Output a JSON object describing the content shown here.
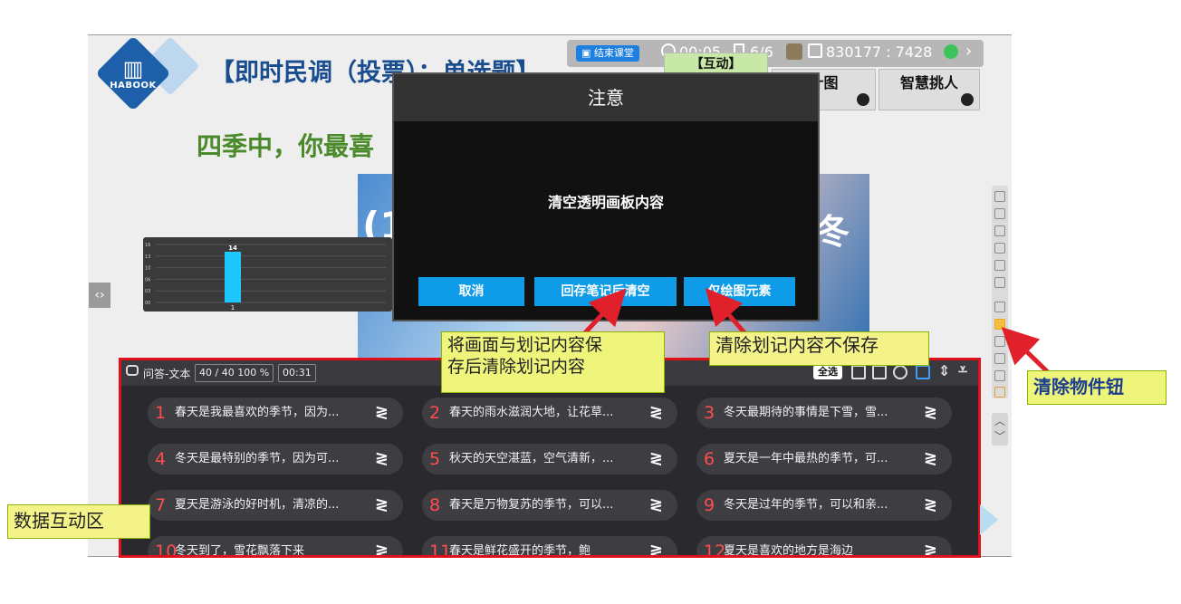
{
  "slide": {
    "logo_text": "HABOOK",
    "title": "【即时民调（投票）：单选题】",
    "question": "四季中，你最喜",
    "image_label_1": "(1",
    "image_label_2": "冬"
  },
  "mini_chart": {
    "chart_data": {
      "type": "bar",
      "categories": [
        "1"
      ],
      "values": [
        14
      ],
      "ytick_labels": [
        "00",
        "03",
        "06",
        "10",
        "13",
        "16"
      ],
      "ylim": [
        0,
        16
      ]
    }
  },
  "toolbar": {
    "end_class": "结束课堂",
    "timer": "00:05",
    "page": "6/6",
    "code": "830177 : 7428",
    "chevron": "›"
  },
  "feature_buttons": {
    "interact": "【互动】",
    "stats": "计图",
    "pick": "智慧挑人"
  },
  "modal": {
    "title": "注意",
    "message": "清空透明画板内容",
    "cancel": "取消",
    "save_and_clear": "回存笔记后清空",
    "clear_drawing": "仅绘图元素"
  },
  "panel": {
    "type_label": "问答-文本",
    "count": "40 / 40",
    "percent": "100 %",
    "time": "00:31",
    "select_all": "全选",
    "answers": [
      {
        "num": "1",
        "text": "春天是我最喜欢的季节，因为..."
      },
      {
        "num": "2",
        "text": "春天的雨水滋润大地，让花草..."
      },
      {
        "num": "3",
        "text": "冬天最期待的事情是下雪，雪..."
      },
      {
        "num": "4",
        "text": "冬天是最特别的季节，因为可..."
      },
      {
        "num": "5",
        "text": "秋天的天空湛蓝，空气清新，..."
      },
      {
        "num": "6",
        "text": "夏天是一年中最热的季节，可..."
      },
      {
        "num": "7",
        "text": "夏天是游泳的好时机，清凉的..."
      },
      {
        "num": "8",
        "text": "春天是万物复苏的季节，可以..."
      },
      {
        "num": "9",
        "text": "冬天是过年的季节，可以和亲..."
      },
      {
        "num": "10",
        "text": "冬天到了，雪花飘落下来"
      },
      {
        "num": "11",
        "text": "春天是鲜花盛开的季节，鲍"
      },
      {
        "num": "12",
        "text": "夏天是喜欢的地方是海边"
      }
    ]
  },
  "nav": {
    "left": "‹›"
  },
  "callouts": {
    "save_line1": "将画面与划记内容保",
    "save_line2": "存后清除划记内容",
    "clear": "清除划记内容不保存",
    "data_area": "数据互动区",
    "remove_button": "清除物件钮"
  },
  "colors": {
    "accent_blue": "#0e9be8",
    "panel_border": "#e0101a",
    "callout_bg": "#f3f38a",
    "answer_number": "#ff4d4d",
    "arrow_red": "#e0202a"
  }
}
